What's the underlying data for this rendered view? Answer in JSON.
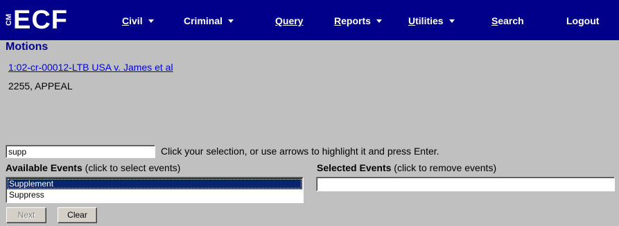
{
  "nav": {
    "logo_small": "CM",
    "logo_main": "ECF",
    "items": [
      {
        "label": "Civil",
        "underline": "C",
        "rest": "ivil",
        "dropdown": true
      },
      {
        "label": "Criminal",
        "underline": "",
        "rest": "Criminal",
        "dropdown": true
      },
      {
        "label": "Query",
        "underline": "Q",
        "rest": "uery",
        "dropdown": false
      },
      {
        "label": "Reports",
        "underline": "R",
        "rest": "eports",
        "dropdown": true
      },
      {
        "label": "Utilities",
        "underline": "U",
        "rest": "tilities",
        "dropdown": true
      },
      {
        "label": "Search",
        "underline": "S",
        "rest": "earch",
        "dropdown": false
      },
      {
        "label": "Logout",
        "underline": "",
        "rest": "Logout",
        "dropdown": false
      }
    ]
  },
  "page": {
    "title": "Motions",
    "case_link": "1:02-cr-00012-LTB USA v. James et al",
    "case_subtitle": "2255, APPEAL"
  },
  "search": {
    "value": "supp",
    "hint": "Click your selection, or use arrows to highlight it and press Enter."
  },
  "available": {
    "label_bold": "Available Events",
    "label_note": "(click to select events)",
    "options": [
      "Supplement",
      "Suppress"
    ],
    "selected_option": "Supplement"
  },
  "selected": {
    "label_bold": "Selected Events",
    "label_note": "(click to remove events)",
    "options": []
  },
  "buttons": {
    "next_label": "Next",
    "clear_label": "Clear"
  },
  "colors": {
    "navbar": "#00008b",
    "background": "#c0c0c0",
    "title": "#00008b",
    "link": "#0000ee",
    "selection": "#0a246a"
  }
}
